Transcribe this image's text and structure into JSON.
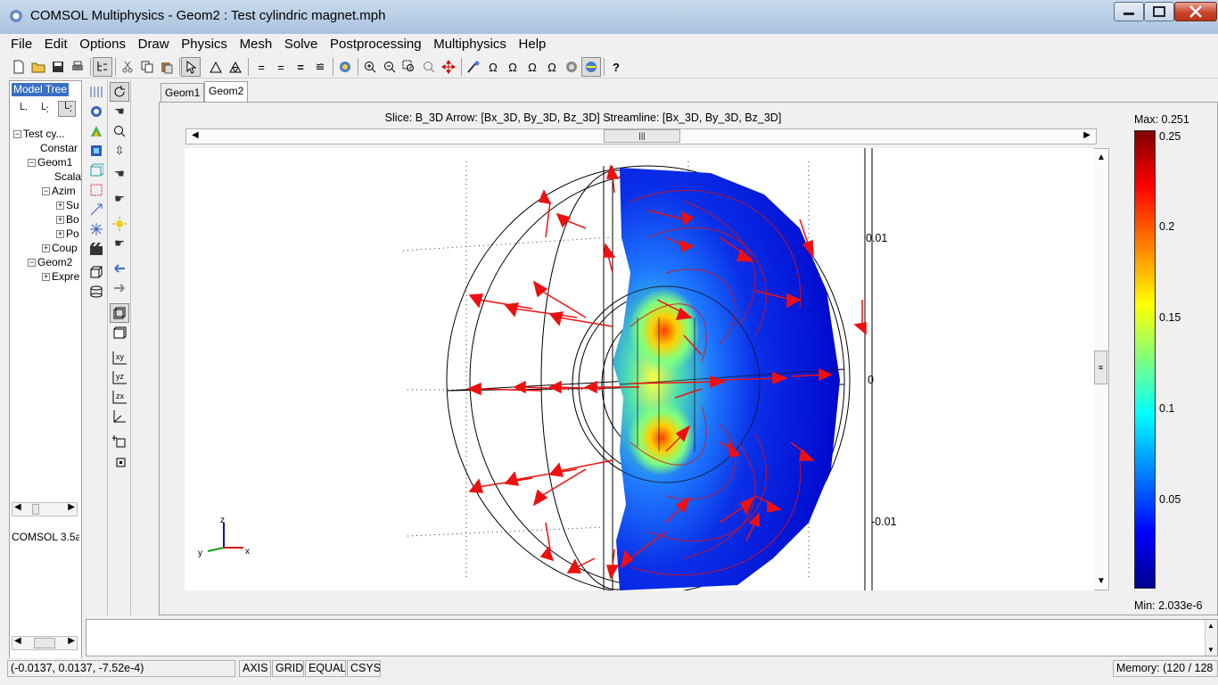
{
  "window": {
    "title": "COMSOL Multiphysics - Geom2 : Test cylindric magnet.mph"
  },
  "menu": [
    "File",
    "Edit",
    "Options",
    "Draw",
    "Physics",
    "Mesh",
    "Solve",
    "Postprocessing",
    "Multiphysics",
    "Help"
  ],
  "toolbar_icons": [
    "new-icon",
    "open-icon",
    "save-icon",
    "print-icon",
    "model-tree-icon",
    "cut-icon",
    "copy-icon",
    "paste-icon",
    "select-icon",
    "mesh-icon",
    "refine-mesh-icon",
    "solve-icon",
    "solve-restart-icon",
    "solver-params-icon",
    "solver-manager-icon",
    "plot-icon",
    "zoom-in-icon",
    "zoom-out-icon",
    "zoom-window-icon",
    "zoom-selected-icon",
    "zoom-extents-icon",
    "plot-params-icon",
    "animate-icon",
    "domain-plot-icon",
    "subdomain-integration-icon",
    "boundary-integration-icon",
    "point-integration-icon",
    "headlight-icon",
    "help-icon"
  ],
  "model_tree": {
    "label": "Model Tree",
    "items": [
      {
        "label": "Test cy...",
        "level": 0,
        "exp": "minus"
      },
      {
        "label": "Constar",
        "level": 1,
        "exp": "none"
      },
      {
        "label": "Geom1",
        "level": 1,
        "exp": "minus"
      },
      {
        "label": "Scala",
        "level": 2,
        "exp": "none"
      },
      {
        "label": "Azim",
        "level": 2,
        "exp": "minus"
      },
      {
        "label": "Su",
        "level": 3,
        "exp": "plus"
      },
      {
        "label": "Bo",
        "level": 3,
        "exp": "plus"
      },
      {
        "label": "Po",
        "level": 3,
        "exp": "plus"
      },
      {
        "label": "Coup",
        "level": 2,
        "exp": "plus"
      },
      {
        "label": "Geom2",
        "level": 1,
        "exp": "minus"
      },
      {
        "label": "Expre",
        "level": 2,
        "exp": "plus"
      }
    ],
    "version": "COMSOL 3.5a"
  },
  "tabs": [
    "Geom1",
    "Geom2"
  ],
  "active_tab": "Geom2",
  "plot": {
    "title": "Slice: B_3D   Arrow: [Bx_3D, By_3D, Bz_3D]   Streamline: [Bx_3D, By_3D, Bz_3D]",
    "axis_labels": [
      "0.01",
      "0",
      "-0.01"
    ],
    "triad": {
      "z": "z",
      "y": "y",
      "x": "x"
    }
  },
  "colorbar": {
    "max_label": "Max: 0.251",
    "min_label": "Min: 2.033e-6",
    "ticks": [
      "0.25",
      "0.2",
      "0.15",
      "0.1",
      "0.05"
    ],
    "colormap": "jet"
  },
  "status": {
    "coords": "(-0.0137, 0.0137, -7.52e-4)",
    "buttons": [
      "AXIS",
      "GRID",
      "EQUAL",
      "CSYS"
    ],
    "memory": "Memory: (120 / 128"
  }
}
